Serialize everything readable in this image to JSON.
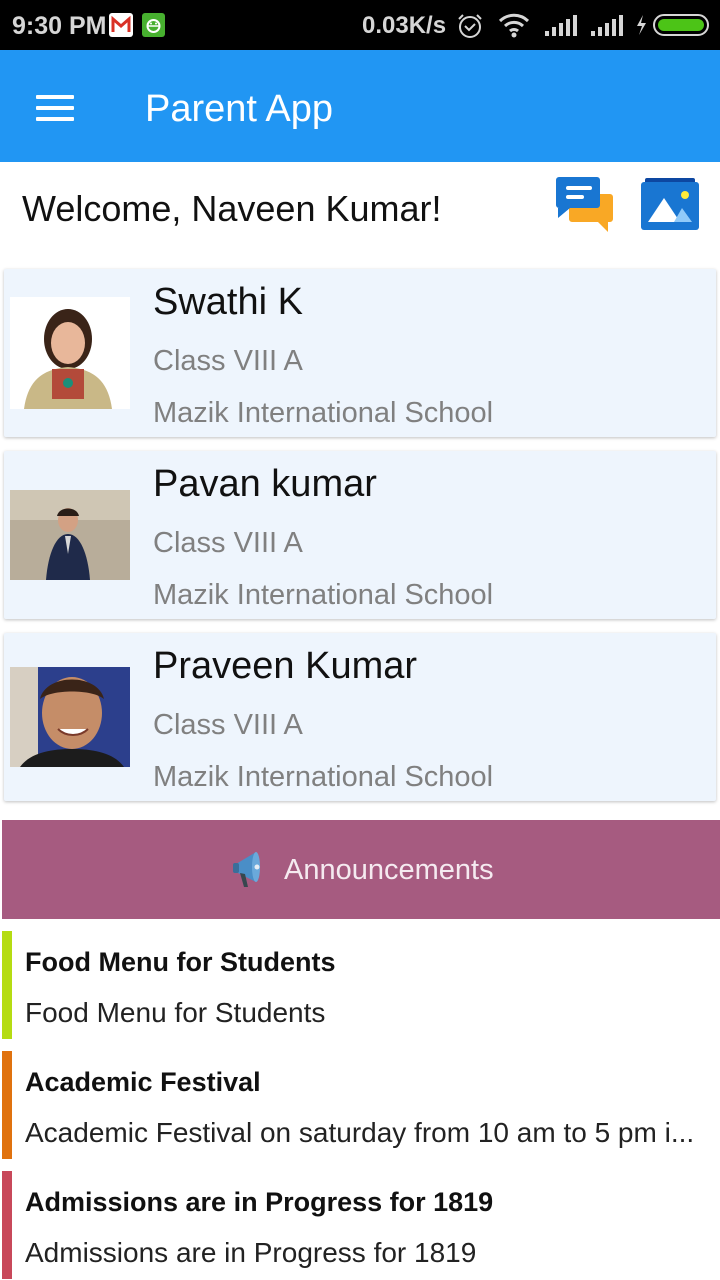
{
  "status_bar": {
    "time": "9:30 PM",
    "notification_icons": [
      "gmail-icon",
      "android-app-icon"
    ],
    "network_speed": "0.03K/s",
    "system_icons": [
      "alarm-icon",
      "wifi-icon",
      "signal-icon",
      "signal-icon",
      "charging-icon",
      "battery-icon"
    ],
    "battery_color": "#4cc417"
  },
  "app_bar": {
    "title": "Parent App",
    "menu_icon": "hamburger-menu-icon",
    "color": "#2196f3"
  },
  "header": {
    "welcome_text": "Welcome, Naveen Kumar!",
    "actions": [
      {
        "icon": "chat-messages-icon",
        "label": "Messages"
      },
      {
        "icon": "photo-gallery-icon",
        "label": "Gallery"
      }
    ]
  },
  "students": [
    {
      "name": "Swathi K",
      "class": "Class VIII A",
      "school": "Mazik International School",
      "photo": "student-photo-girl"
    },
    {
      "name": "Pavan kumar",
      "class": "Class VIII A",
      "school": "Mazik International School",
      "photo": "student-photo-boy-uniform"
    },
    {
      "name": "Praveen Kumar",
      "class": "Class VIII A",
      "school": "Mazik International School",
      "photo": "student-photo-boy-smiling"
    }
  ],
  "announcements": {
    "header_label": "Announcements",
    "header_icon": "megaphone-icon",
    "header_color": "#a65b80",
    "items": [
      {
        "title": "Food Menu for Students",
        "body": "Food Menu for Students",
        "color": "#b5dc12"
      },
      {
        "title": "Academic Festival",
        "body": "Academic Festival on saturday from 10 am to 5 pm i...",
        "color": "#e0720e"
      },
      {
        "title": "Admissions are in Progress for 1819",
        "body": "Admissions are in Progress for 1819",
        "color": "#c8485a"
      }
    ]
  }
}
